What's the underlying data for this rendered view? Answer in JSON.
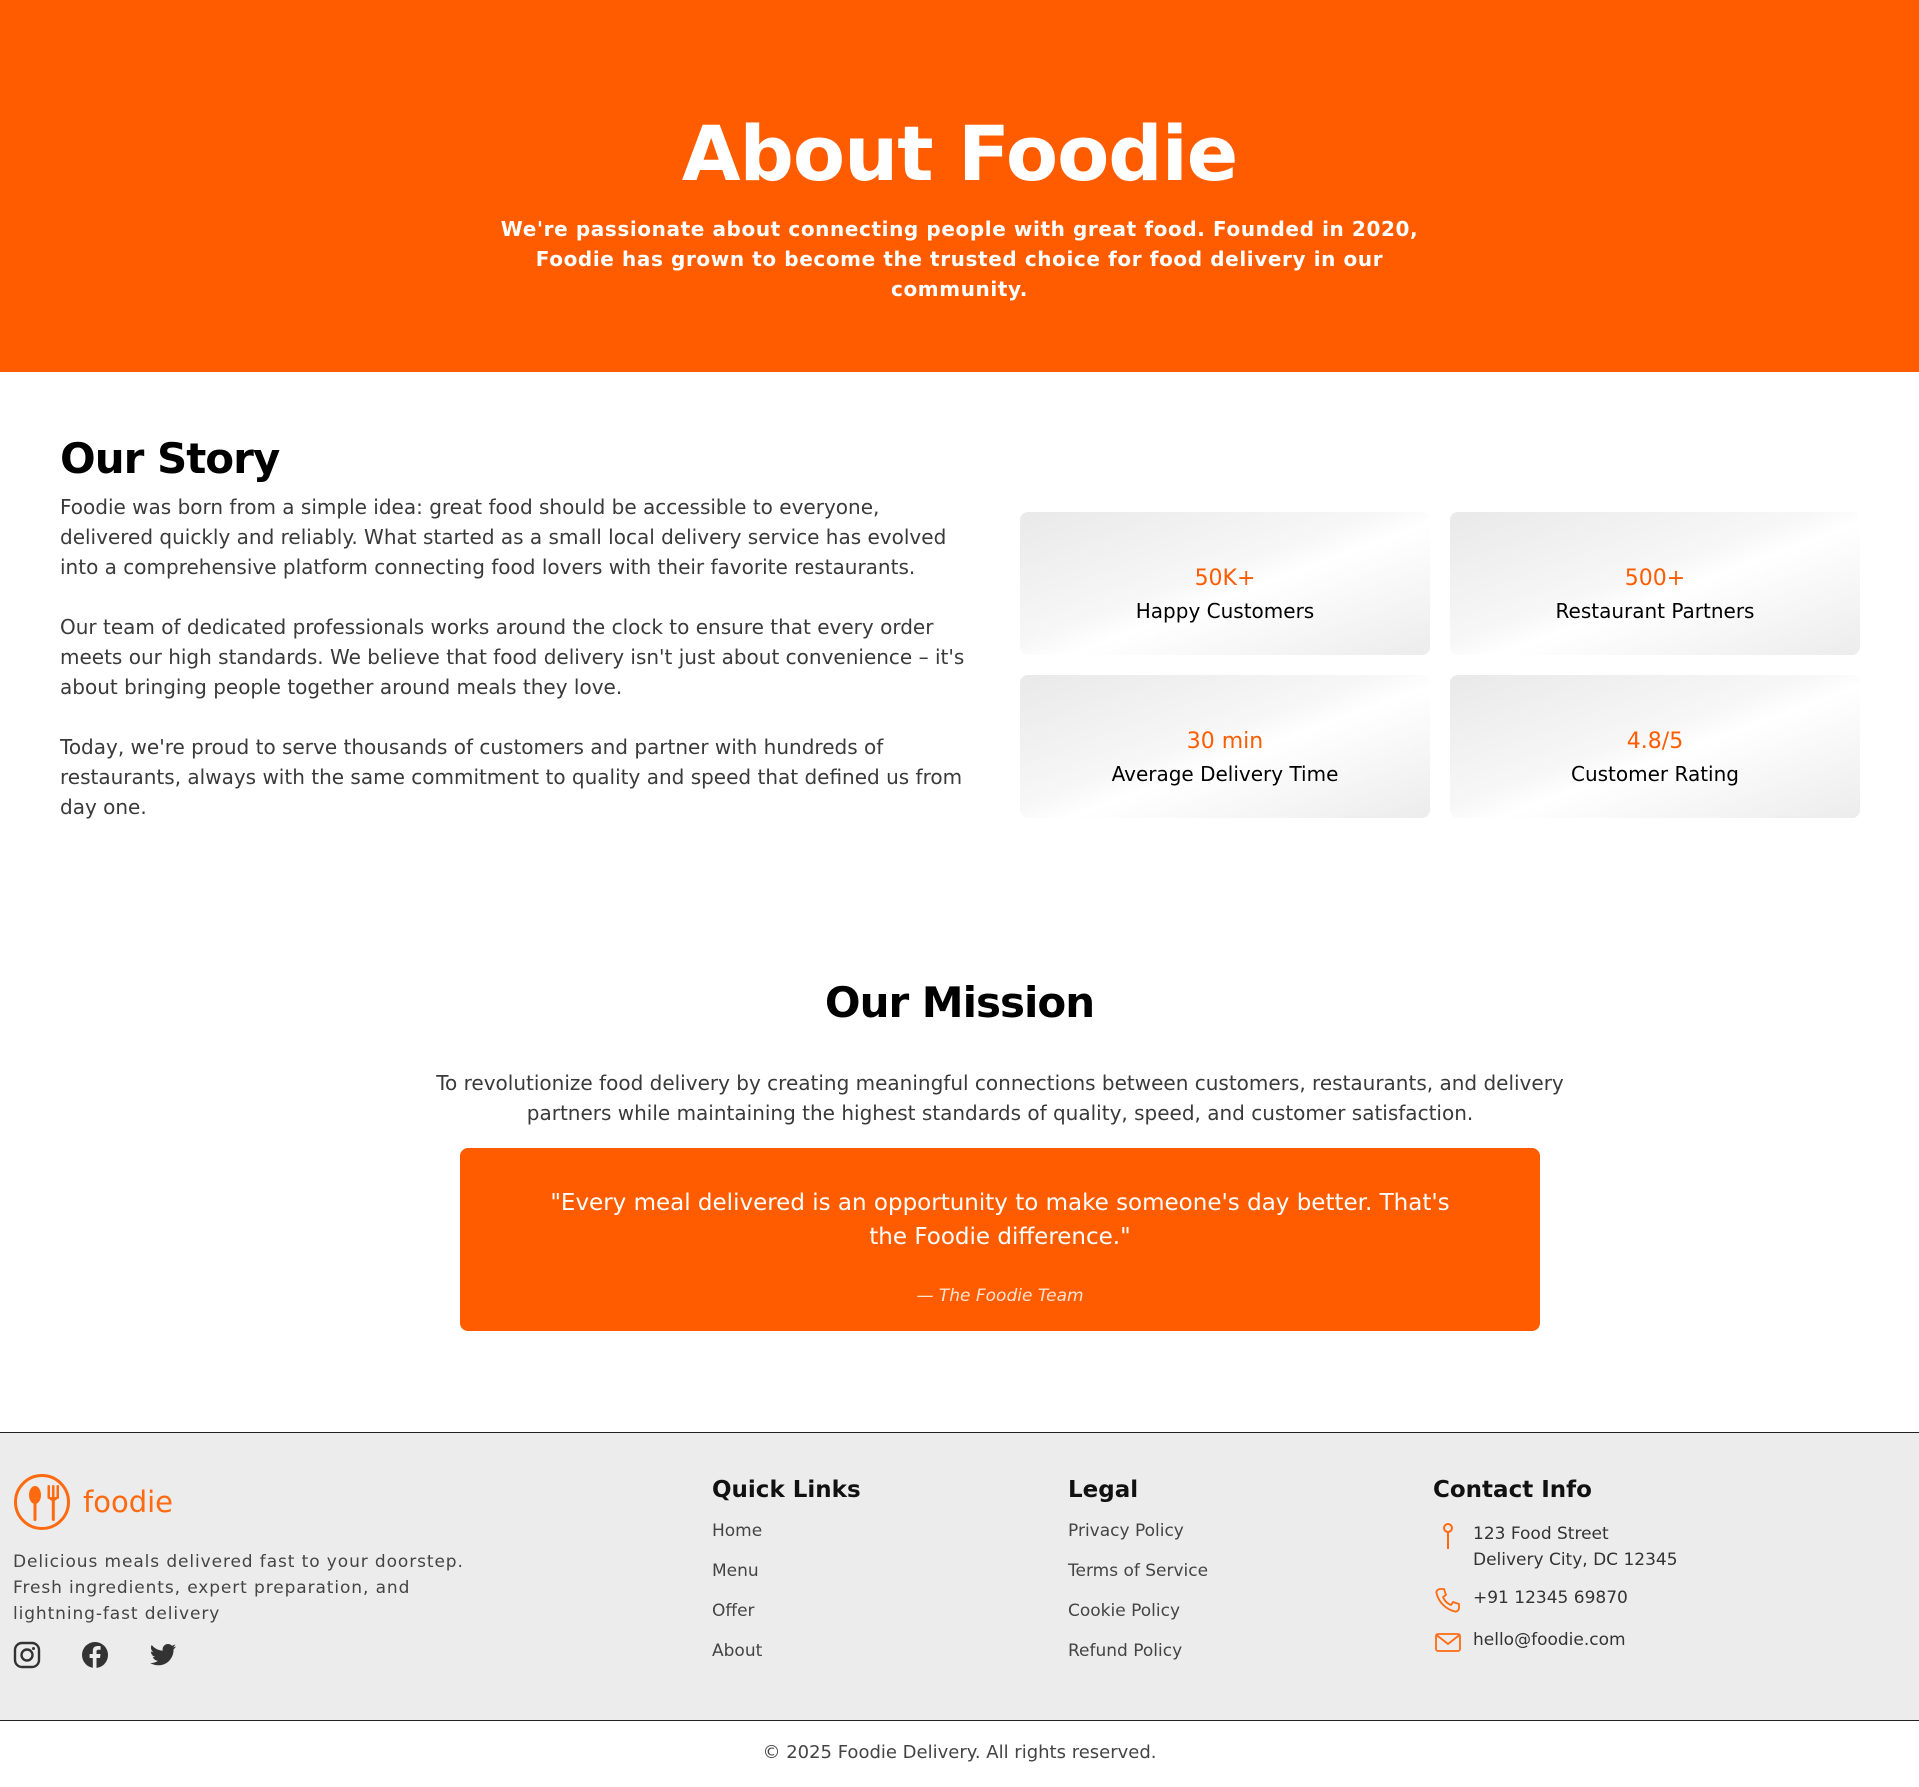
{
  "hero": {
    "title": "About Foodie",
    "subtitle": "We're passionate about connecting people with great food. Founded in 2020, Foodie has grown to become the trusted choice for food delivery in our community."
  },
  "story": {
    "title": "Our Story",
    "paragraphs": [
      "Foodie was born from a simple idea: great food should be accessible to everyone, delivered quickly and reliably. What started as a small local delivery service has evolved into a comprehensive platform connecting food lovers with their favorite restaurants.",
      "Our team of dedicated professionals works around the clock to ensure that every order meets our high standards. We believe that food delivery isn't just about convenience – it's about bringing people together around meals they love.",
      "Today, we're proud to serve thousands of customers and partner with hundreds of restaurants, always with the same commitment to quality and speed that defined us from day one."
    ],
    "stats": [
      {
        "value": "50K+",
        "label": "Happy Customers"
      },
      {
        "value": "500+",
        "label": "Restaurant Partners"
      },
      {
        "value": "30 min",
        "label": "Average Delivery Time"
      },
      {
        "value": "4.8/5",
        "label": "Customer Rating"
      }
    ]
  },
  "mission": {
    "title": "Our Mission",
    "text": "To revolutionize food delivery by creating meaningful connections between customers, restaurants, and delivery partners while maintaining the highest standards of quality, speed, and customer satisfaction.",
    "quote": "\"Every meal delivered is an opportunity to make someone's day better. That's the Foodie difference.\"",
    "author": "— The Foodie Team"
  },
  "footer": {
    "brand": "foodie",
    "description": "Delicious meals delivered fast to your doorstep. Fresh ingredients, expert preparation, and lightning-fast delivery",
    "social_icons": [
      "instagram-icon",
      "facebook-icon",
      "twitter-icon"
    ],
    "quick_links": {
      "title": "Quick Links",
      "items": [
        "Home",
        "Menu",
        "Offer",
        "About"
      ]
    },
    "legal": {
      "title": "Legal",
      "items": [
        "Privacy Policy",
        "Terms of Service",
        "Cookie Policy",
        "Refund Policy"
      ]
    },
    "contact": {
      "title": "Contact Info",
      "address_line1": "123 Food Street",
      "address_line2": "Delivery City, DC 12345",
      "phone": "+91 12345 69870",
      "email": "hello@foodie.com"
    },
    "copyright": "© 2025 Foodie Delivery. All rights reserved."
  },
  "colors": {
    "accent": "#ff5c00",
    "footer_bg": "#ececec"
  }
}
